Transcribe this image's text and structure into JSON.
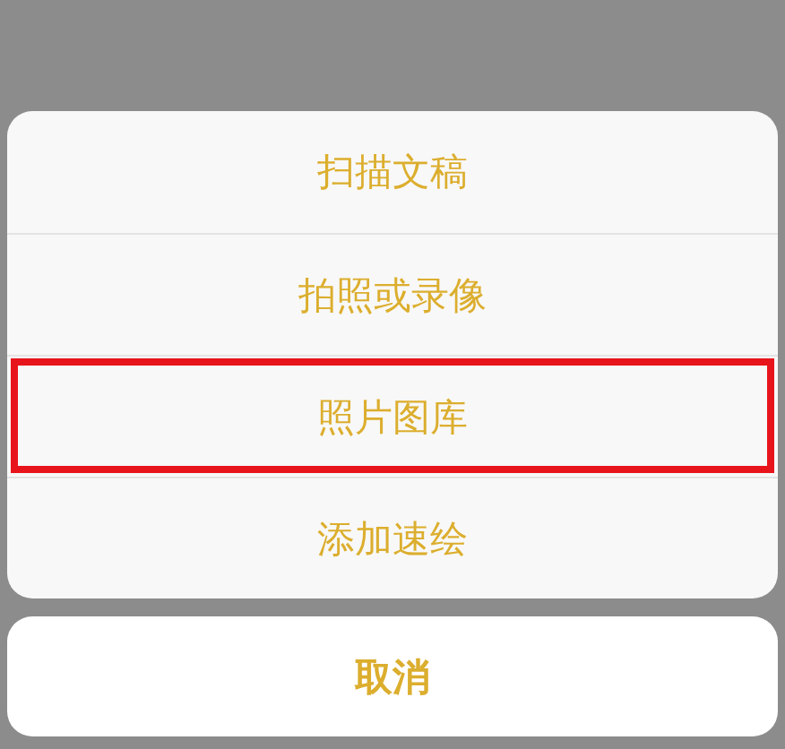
{
  "action_sheet": {
    "options": [
      {
        "label": "扫描文稿",
        "highlighted": false
      },
      {
        "label": "拍照或录像",
        "highlighted": false
      },
      {
        "label": "照片图库",
        "highlighted": true
      },
      {
        "label": "添加速绘",
        "highlighted": false
      }
    ]
  },
  "cancel_button": {
    "label": "取消"
  }
}
